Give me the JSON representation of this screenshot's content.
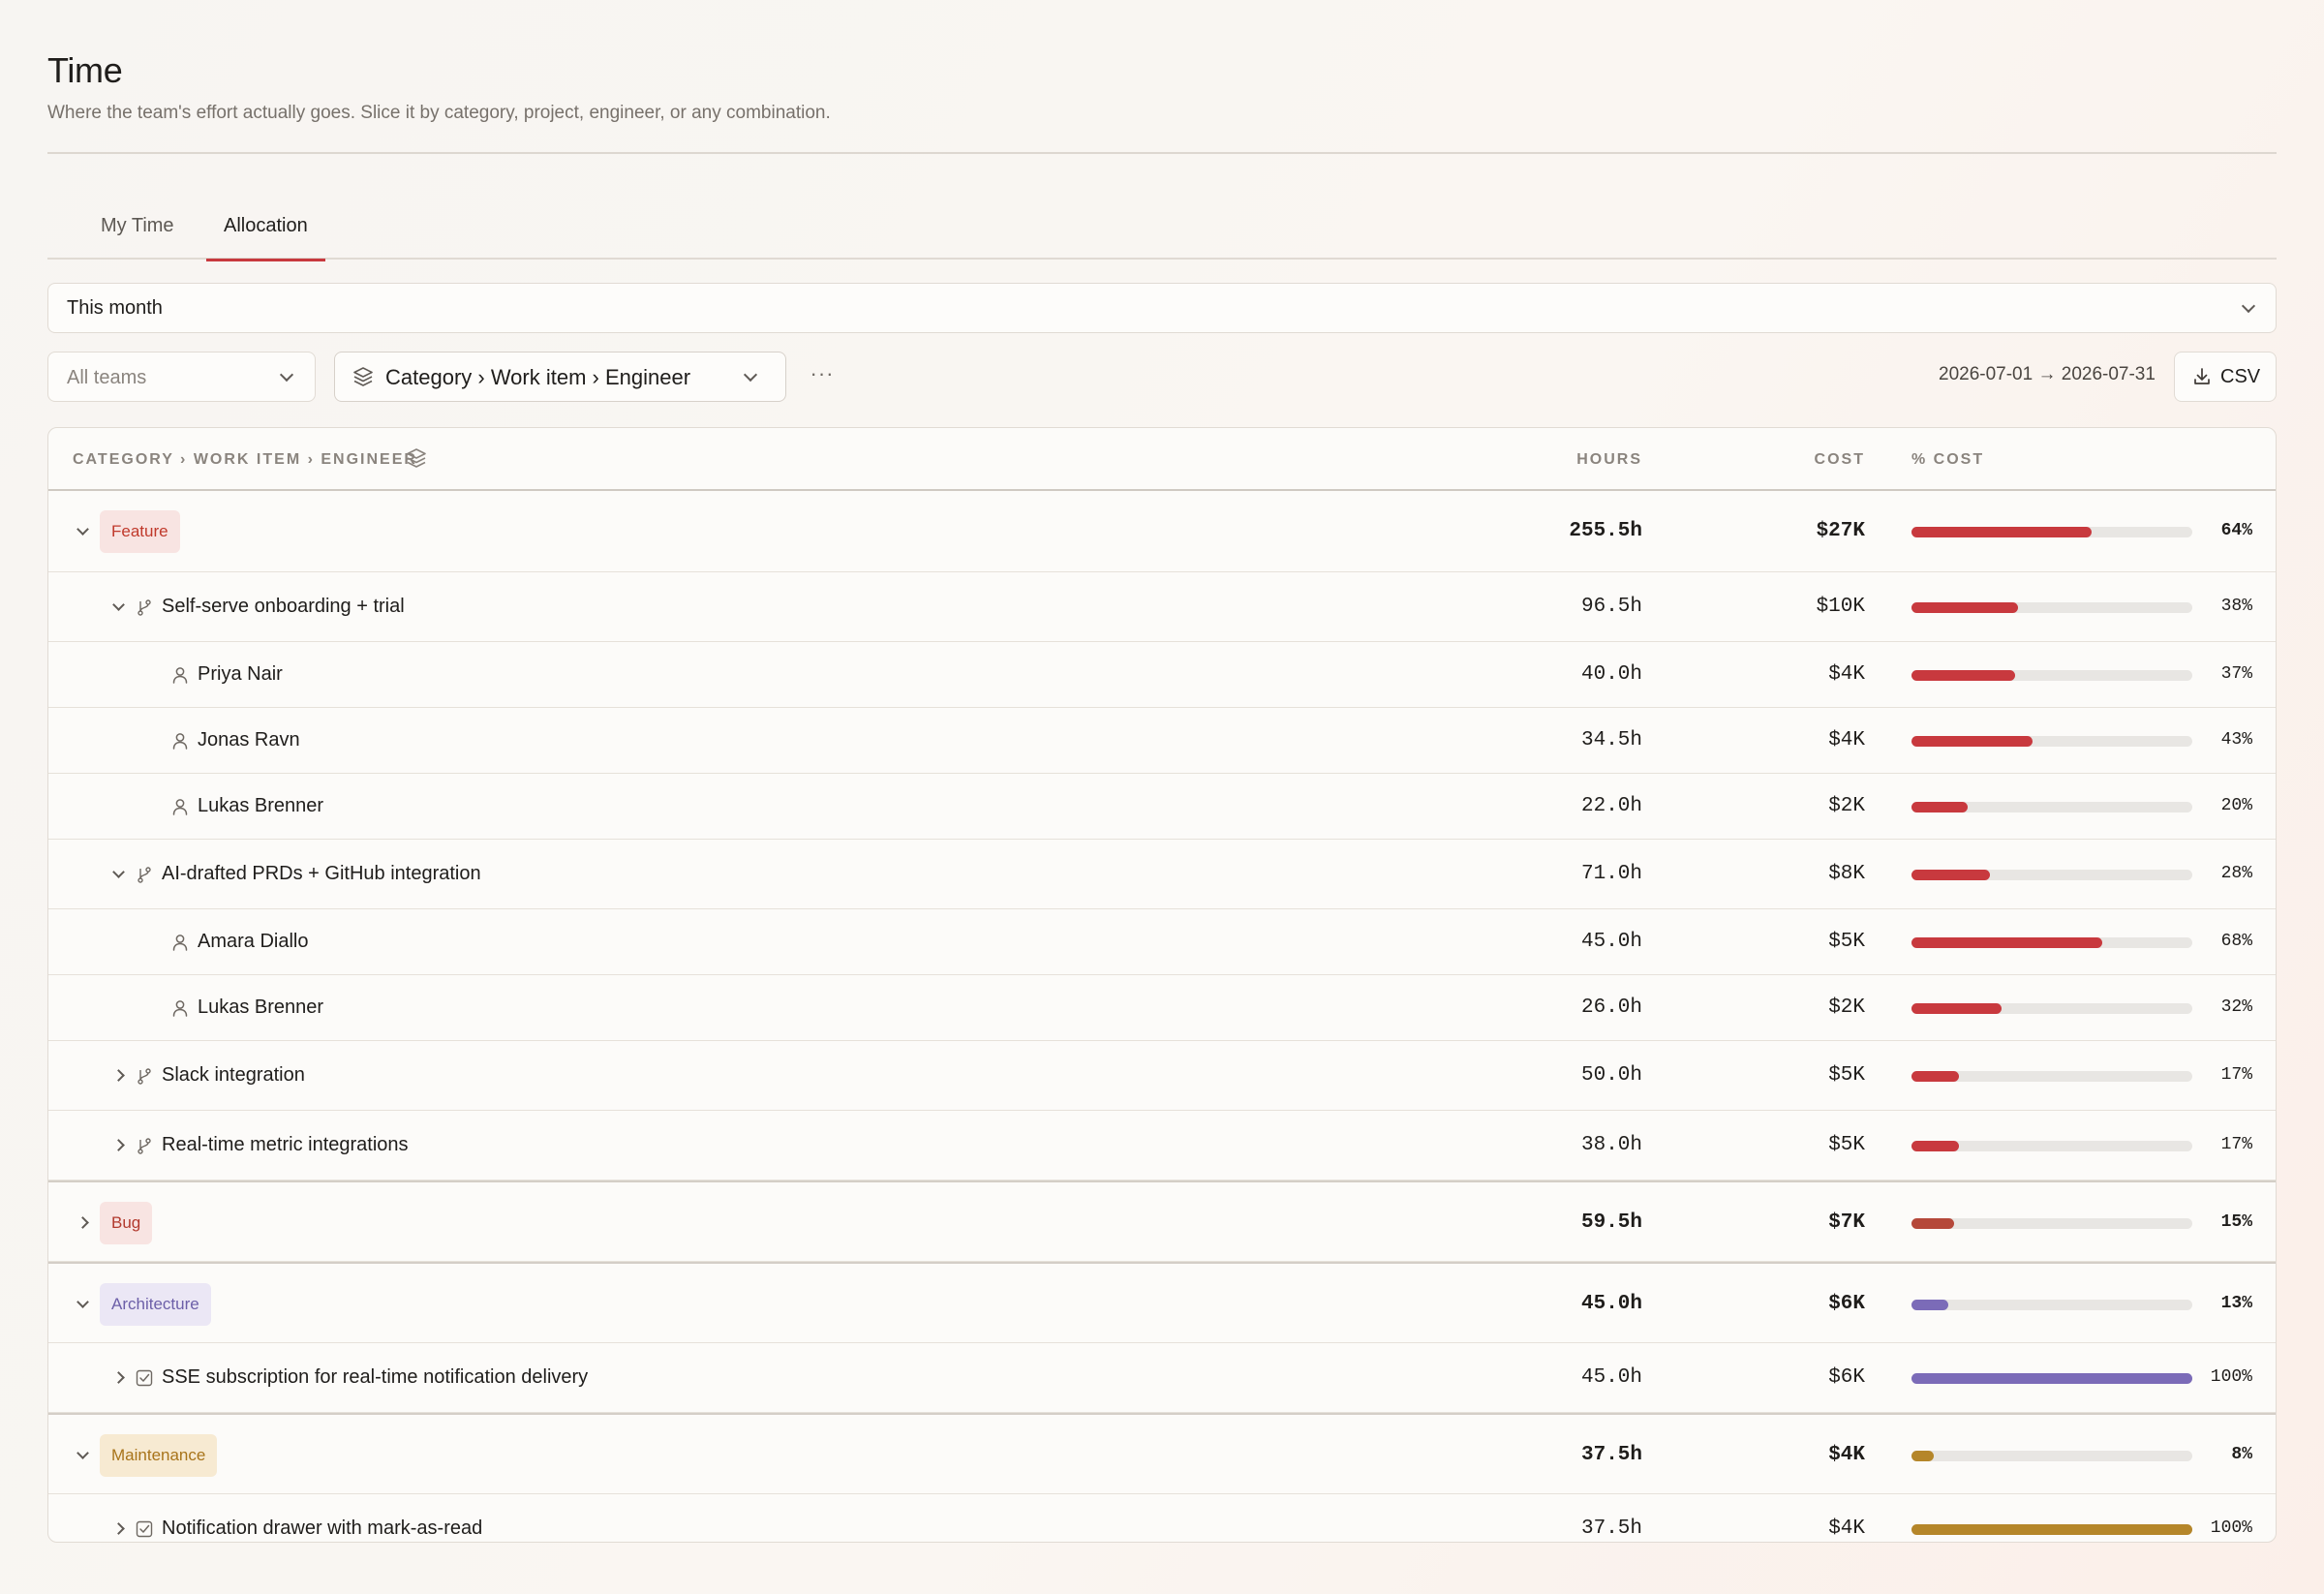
{
  "header": {
    "title": "Time",
    "subtitle": "Where the team's effort actually goes. Slice it by category, project, engineer, or any combination."
  },
  "tabs": [
    {
      "label": "My Time",
      "active": false
    },
    {
      "label": "Allocation",
      "active": true
    }
  ],
  "filters": {
    "range": "This month",
    "teams_placeholder": "All teams",
    "grouping": "Category › Work item › Engineer",
    "more": "···",
    "date_range": "2026-07-01 → 2026-07-31",
    "csv_label": "CSV"
  },
  "table": {
    "columns": {
      "group": "CATEGORY › WORK ITEM › ENGINEER",
      "hours": "HOURS",
      "cost": "COST",
      "pct_cost": "% COST"
    },
    "rows": [
      {
        "level": "category",
        "label": "Feature",
        "expanded": true,
        "hours": "255.5h",
        "cost": "$27K",
        "pct": "64%",
        "fill": 0.64,
        "color": "#c8393e"
      },
      {
        "level": "item",
        "icon": "branch-icon",
        "label": "Self-serve onboarding + trial",
        "expanded": true,
        "hours": "96.5h",
        "cost": "$10K",
        "pct": "38%",
        "fill": 0.38,
        "color": "#c8393e"
      },
      {
        "level": "person",
        "label": "Priya Nair",
        "hours": "40.0h",
        "cost": "$4K",
        "pct": "37%",
        "fill": 0.37,
        "color": "#c8393e"
      },
      {
        "level": "person",
        "label": "Jonas Ravn",
        "hours": "34.5h",
        "cost": "$4K",
        "pct": "43%",
        "fill": 0.43,
        "color": "#c8393e"
      },
      {
        "level": "person",
        "label": "Lukas Brenner",
        "hours": "22.0h",
        "cost": "$2K",
        "pct": "20%",
        "fill": 0.2,
        "color": "#c8393e"
      },
      {
        "level": "item",
        "icon": "branch-icon",
        "label": "AI-drafted PRDs + GitHub integration",
        "expanded": true,
        "hours": "71.0h",
        "cost": "$8K",
        "pct": "28%",
        "fill": 0.28,
        "color": "#c8393e"
      },
      {
        "level": "person",
        "label": "Amara Diallo",
        "hours": "45.0h",
        "cost": "$5K",
        "pct": "68%",
        "fill": 0.68,
        "color": "#c8393e"
      },
      {
        "level": "person",
        "label": "Lukas Brenner",
        "hours": "26.0h",
        "cost": "$2K",
        "pct": "32%",
        "fill": 0.32,
        "color": "#c8393e"
      },
      {
        "level": "item",
        "icon": "branch-icon",
        "label": "Slack integration",
        "expanded": false,
        "hours": "50.0h",
        "cost": "$5K",
        "pct": "17%",
        "fill": 0.17,
        "color": "#c8393e"
      },
      {
        "level": "item",
        "icon": "branch-icon",
        "label": "Real-time metric integrations",
        "expanded": false,
        "hours": "38.0h",
        "cost": "$5K",
        "pct": "17%",
        "fill": 0.17,
        "color": "#c8393e"
      },
      {
        "level": "category",
        "label": "Bug",
        "expanded": false,
        "hours": "59.5h",
        "cost": "$7K",
        "pct": "15%",
        "fill": 0.15,
        "color": "#b5483a"
      },
      {
        "level": "category",
        "label": "Architecture",
        "expanded": true,
        "hours": "45.0h",
        "cost": "$6K",
        "pct": "13%",
        "fill": 0.13,
        "color": "#7b6bb8"
      },
      {
        "level": "item",
        "icon": "checkbox-icon",
        "label": "SSE subscription for real-time notification delivery",
        "expanded": false,
        "hours": "45.0h",
        "cost": "$6K",
        "pct": "100%",
        "fill": 1.0,
        "color": "#7b6bb8"
      },
      {
        "level": "category",
        "label": "Maintenance",
        "expanded": true,
        "hours": "37.5h",
        "cost": "$4K",
        "pct": "8%",
        "fill": 0.08,
        "color": "#b5862a"
      },
      {
        "level": "item",
        "icon": "checkbox-icon",
        "label": "Notification drawer with mark-as-read",
        "expanded": false,
        "hours": "37.5h",
        "cost": "$4K",
        "pct": "100%",
        "fill": 1.0,
        "color": "#b5862a"
      }
    ]
  },
  "colors": {
    "accent": "#c8393e",
    "feature_badge_bg": "#f8e4e2",
    "feature_badge_fg": "#c0392b",
    "bug_badge_bg": "#f8e4e2",
    "bug_badge_fg": "#b23a2e",
    "architecture_badge_bg": "#ebe7f5",
    "architecture_badge_fg": "#6c5fa8",
    "maintenance_badge_bg": "#f7ead2",
    "maintenance_badge_fg": "#a8741a"
  }
}
